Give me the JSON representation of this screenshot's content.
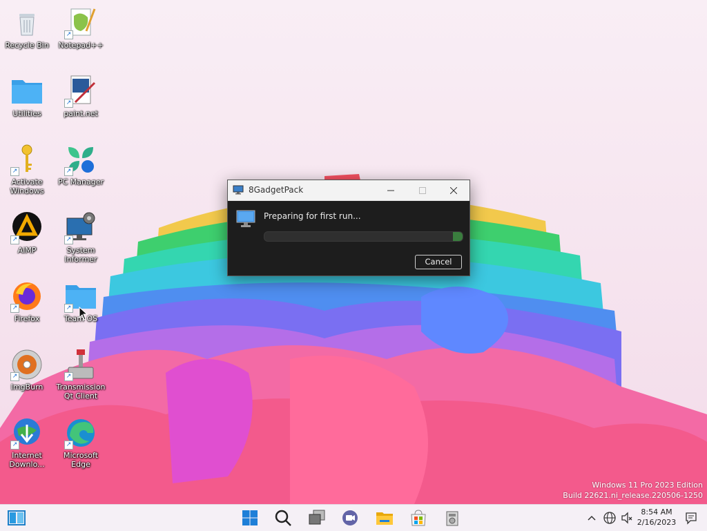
{
  "desktop": {
    "icons": [
      {
        "label": "Recycle Bin"
      },
      {
        "label": "Notepad++"
      },
      {
        "label": "Utilities"
      },
      {
        "label": "paint.net"
      },
      {
        "label": "Activate Windows"
      },
      {
        "label": "PC Manager"
      },
      {
        "label": "AIMP"
      },
      {
        "label": "System Informer"
      },
      {
        "label": "Firefox"
      },
      {
        "label": "Team OS"
      },
      {
        "label": "ImgBurn"
      },
      {
        "label": "Transmission Qt Client"
      },
      {
        "label": "Internet Downlo..."
      },
      {
        "label": "Microsoft Edge"
      }
    ]
  },
  "dialog": {
    "title": "8GadgetPack",
    "message": "Preparing for first run...",
    "progress_fraction": 0.05,
    "cancel_label": "Cancel"
  },
  "watermark": {
    "line1": "Windows 11 Pro 2023 Edition",
    "line2": "Build 22621.ni_release.220506-1250"
  },
  "taskbar": {
    "clock_time": "8:54 AM",
    "clock_date": "2/16/2023"
  },
  "colors": {
    "accent": "#0078d4",
    "progress": "#3a7d3e",
    "dialog_bg": "#1d1d1d"
  }
}
